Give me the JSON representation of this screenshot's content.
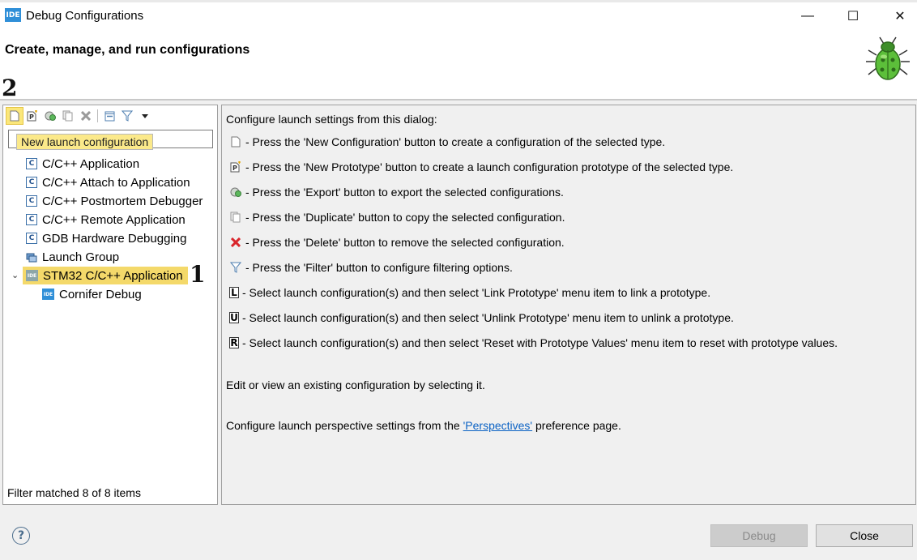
{
  "window": {
    "app_icon_text": "IDE",
    "title": "Debug Configurations",
    "minimize": "—",
    "maximize": "☐",
    "close": "✕"
  },
  "header": {
    "title": "Create, manage, and run configurations"
  },
  "annotations": {
    "toolbar_mark": "2",
    "tree_mark": "1"
  },
  "toolbar": {
    "buttons": [
      {
        "name": "new-configuration-button",
        "glyph": "▯",
        "highlighted": true
      },
      {
        "name": "new-prototype-button",
        "glyph": "P"
      },
      {
        "name": "export-button",
        "glyph": "⟳"
      },
      {
        "name": "duplicate-button",
        "glyph": "❐"
      },
      {
        "name": "delete-button",
        "glyph": "✖"
      },
      {
        "name": "collapse-all-button",
        "glyph": "⊟"
      },
      {
        "name": "filter-button",
        "glyph": "▽"
      },
      {
        "name": "view-menu-button",
        "glyph": "▾"
      }
    ]
  },
  "filter": {
    "value": "",
    "tooltip": "New launch configuration"
  },
  "tree": {
    "items": [
      {
        "label": "C/C++ Application",
        "icon": "c-icon"
      },
      {
        "label": "C/C++ Attach to Application",
        "icon": "c-icon"
      },
      {
        "label": "C/C++ Postmortem Debugger",
        "icon": "c-icon"
      },
      {
        "label": "C/C++ Remote Application",
        "icon": "c-icon"
      },
      {
        "label": "GDB Hardware Debugging",
        "icon": "c-icon"
      },
      {
        "label": "Launch Group",
        "icon": "launch-group-icon"
      },
      {
        "label": "STM32 C/C++ Application",
        "icon": "ide-icon",
        "selected": true,
        "expanded": true
      },
      {
        "label": "Cornifer Debug",
        "icon": "ide-icon"
      }
    ],
    "status": "Filter matched 8 of 8 items"
  },
  "main": {
    "intro": "Configure launch settings from this dialog:",
    "instructions": [
      {
        "icon": "new-config-icon",
        "text": "- Press the 'New Configuration' button to create a configuration of the selected type."
      },
      {
        "icon": "new-prototype-icon",
        "text": "- Press the 'New Prototype' button to create a launch configuration prototype of the selected type."
      },
      {
        "icon": "export-icon",
        "text": "- Press the 'Export' button to export the selected configurations."
      },
      {
        "icon": "duplicate-icon",
        "text": "- Press the 'Duplicate' button to copy the selected configuration."
      },
      {
        "icon": "delete-icon",
        "text": "- Press the 'Delete' button to remove the selected configuration."
      },
      {
        "icon": "filter-icon",
        "text": "- Press the 'Filter' button to configure filtering options."
      },
      {
        "icon": "link-icon",
        "letter": "L",
        "text": "- Select launch configuration(s) and then select 'Link Prototype' menu item to link a prototype."
      },
      {
        "icon": "unlink-icon",
        "letter": "U",
        "text": "- Select launch configuration(s) and then select 'Unlink Prototype' menu item to unlink a prototype."
      },
      {
        "icon": "reset-icon",
        "letter": "R",
        "text": "- Select launch configuration(s) and then select 'Reset with Prototype Values' menu item to reset with prototype values."
      }
    ],
    "edit_text": "Edit or view an existing configuration by selecting it.",
    "perspective_before": "Configure launch perspective settings from the ",
    "perspective_link": "'Perspectives'",
    "perspective_after": " preference page."
  },
  "footer": {
    "help": "?",
    "debug_label": "Debug",
    "close_label": "Close"
  },
  "colors": {
    "highlight": "#f4d96a",
    "link": "#0b62c4",
    "delete_red": "#d9262c"
  }
}
